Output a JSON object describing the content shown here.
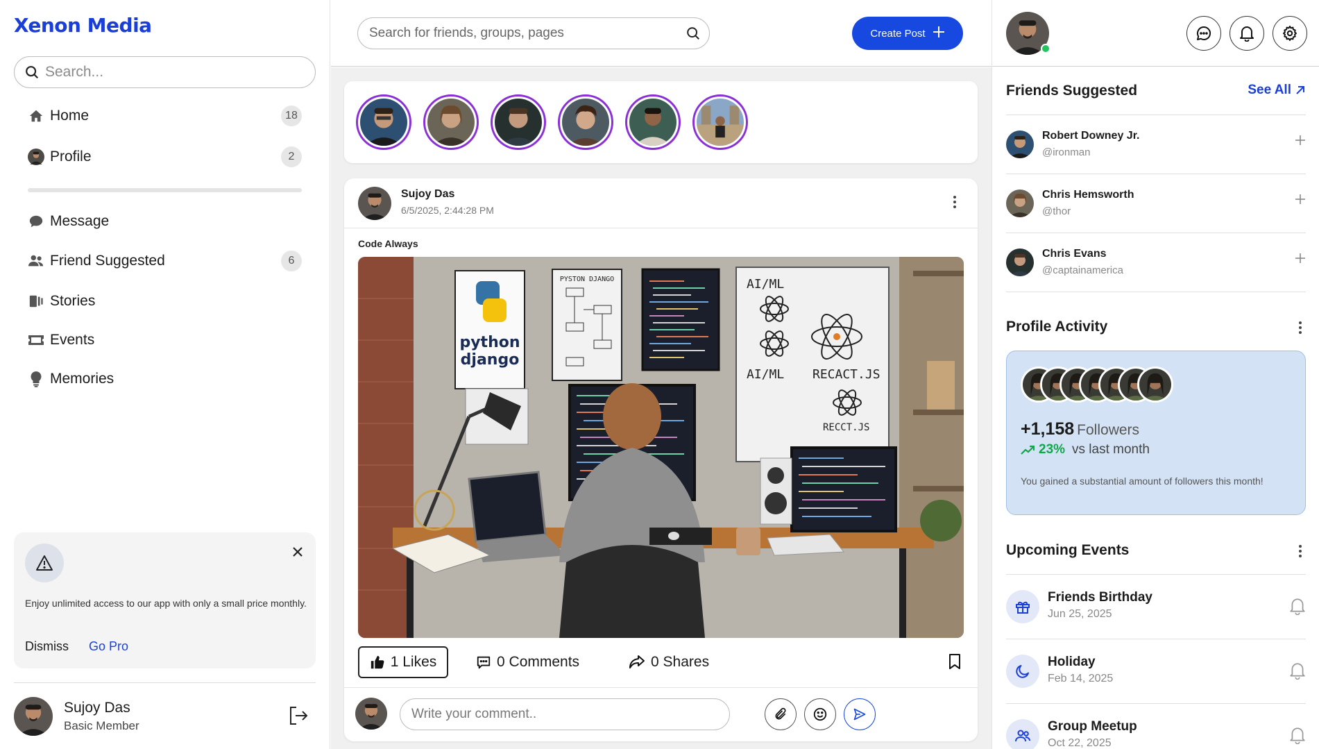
{
  "brand": "Xenon Media",
  "left_search": {
    "placeholder": "Search..."
  },
  "nav": {
    "home": {
      "label": "Home",
      "badge": "18"
    },
    "profile": {
      "label": "Profile",
      "badge": "2"
    },
    "message": {
      "label": "Message"
    },
    "friends": {
      "label": "Friend Suggested",
      "badge": "6"
    },
    "stories": {
      "label": "Stories"
    },
    "events": {
      "label": "Events"
    },
    "memories": {
      "label": "Memories"
    }
  },
  "promo": {
    "text": "Enjoy unlimited access to our app with only a small price monthly.",
    "dismiss": "Dismiss",
    "go_pro": "Go Pro"
  },
  "user": {
    "name": "Sujoy Das",
    "role": "Basic Member"
  },
  "top_search": {
    "placeholder": "Search for friends, groups, pages"
  },
  "create_post": "Create Post",
  "post": {
    "author": "Sujoy Das",
    "date": "6/5/2025, 2:44:28 PM",
    "title": "Code Always",
    "image_texts": {
      "python": "python",
      "django": "django",
      "poster2": "PYSTON DJANGO",
      "wb1": "AI/ML",
      "wb2": "RECACT.JS",
      "wb3": "RECCT.JS",
      "wb4": "AI/ML"
    },
    "likes_count": "1",
    "likes_label": "Likes",
    "comments_count": "0",
    "comments_label": "Comments",
    "shares_count": "0",
    "shares_label": "Shares",
    "comment_placeholder": "Write your comment.."
  },
  "friends_suggested": {
    "title": "Friends Suggested",
    "see_all": "See All",
    "items": [
      {
        "name": "Robert Downey Jr.",
        "handle": "@ironman"
      },
      {
        "name": "Chris Hemsworth",
        "handle": "@thor"
      },
      {
        "name": "Chris Evans",
        "handle": "@captainamerica"
      }
    ]
  },
  "profile_activity": {
    "title": "Profile Activity",
    "count": "+1,158",
    "count_label": "Followers",
    "growth": "23%",
    "growth_label": "vs last month",
    "description": "You gained a substantial amount of followers this month!"
  },
  "upcoming_events": {
    "title": "Upcoming Events",
    "items": [
      {
        "name": "Friends Birthday",
        "date": "Jun 25, 2025",
        "icon": "gift-icon"
      },
      {
        "name": "Holiday",
        "date": "Feb 14, 2025",
        "icon": "moon-icon"
      },
      {
        "name": "Group Meetup",
        "date": "Oct 22, 2025",
        "icon": "group-icon"
      }
    ]
  },
  "colors": {
    "brand": "#1a3fd8",
    "accent": "#1749e0",
    "story_ring": "#8b2fd6",
    "activity_bg": "#d3e3f5",
    "growth": "#14a44d",
    "online": "#22c55e"
  }
}
